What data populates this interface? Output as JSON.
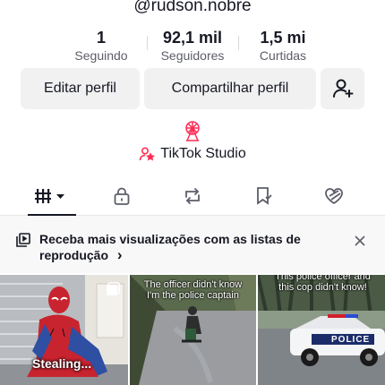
{
  "profile": {
    "username": "@rudson.nobre",
    "stats": [
      {
        "value": "1",
        "label": "Seguindo"
      },
      {
        "value": "92,1 mil",
        "label": "Seguidores"
      },
      {
        "value": "1,5 mi",
        "label": "Curtidas"
      }
    ],
    "edit_label": "Editar perfil",
    "share_label": "Compartilhar perfil",
    "add_friend_icon": "add-person-icon",
    "studio_icon": "ferris-wheel-icon",
    "studio_label": "TikTok Studio"
  },
  "tabs": [
    {
      "name": "videos",
      "icon": "grid-icon"
    },
    {
      "name": "private",
      "icon": "lock-icon"
    },
    {
      "name": "reposts",
      "icon": "repost-icon"
    },
    {
      "name": "favorites",
      "icon": "bookmark-icon"
    },
    {
      "name": "liked",
      "icon": "heart-icon"
    }
  ],
  "banner": {
    "text": "Receba mais visualizações com as listas de reprodução",
    "arrow": "›"
  },
  "videos": [
    {
      "caption": "",
      "overlay": "Stealing..."
    },
    {
      "caption": "The officer didn't know\nI'm the police captain",
      "overlay": ""
    },
    {
      "caption": "This police officer and\nthis cop didn't know!",
      "overlay": "POLICE"
    }
  ],
  "colors": {
    "accent": "#fe2c55",
    "text": "#161823",
    "muted": "#5c5e68",
    "button_bg": "#f1f1f2"
  }
}
